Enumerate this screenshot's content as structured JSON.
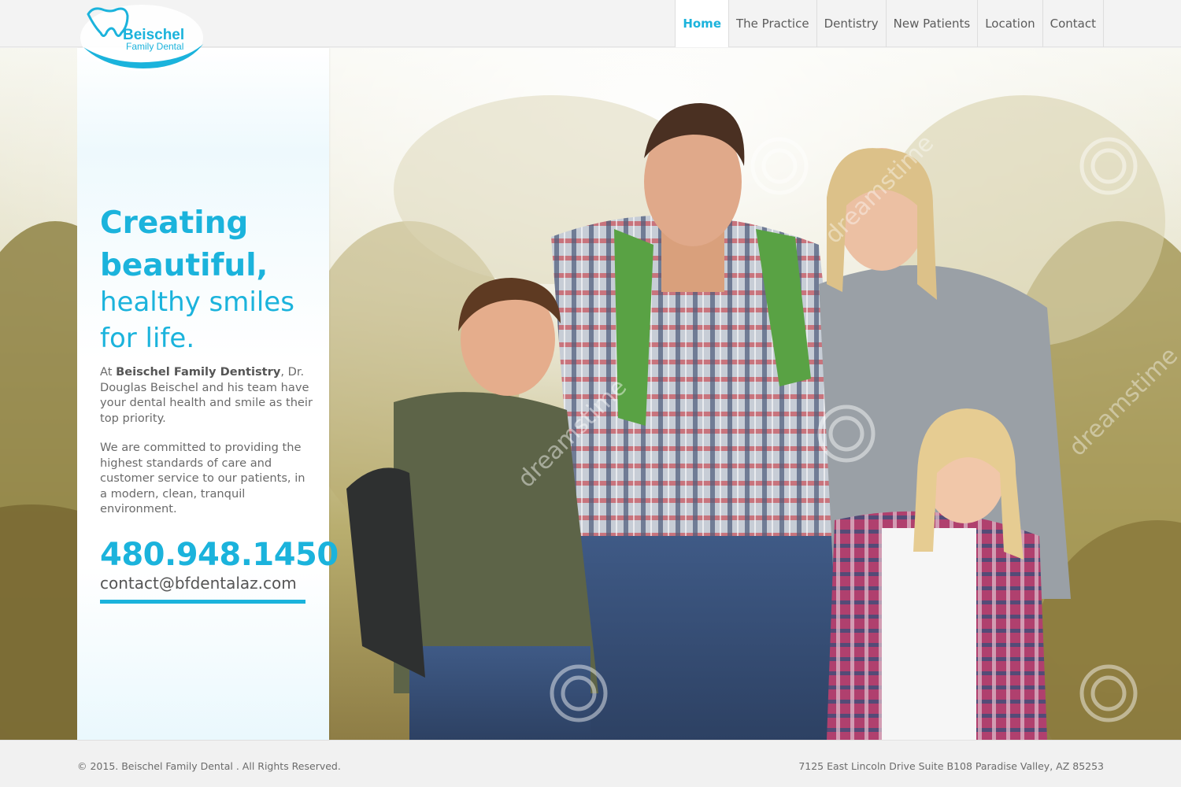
{
  "logo": {
    "name": "Beischel",
    "sub": "Family Dental"
  },
  "nav": {
    "items": [
      {
        "label": "Home"
      },
      {
        "label": "The Practice"
      },
      {
        "label": "Dentistry"
      },
      {
        "label": "New Patients"
      },
      {
        "label": "Location"
      },
      {
        "label": "Contact"
      }
    ],
    "active": "Home"
  },
  "hero": {
    "headline_bold_1": "Creating",
    "headline_bold_2": "beautiful,",
    "headline_light_1": "healthy smiles",
    "headline_light_2": "for life.",
    "p1_prefix": "At ",
    "p1_bold": "Beischel Family Dentistry",
    "p1_rest": ", Dr. Douglas Beischel and his team have your dental health and smile as their top priority.",
    "p2": "We are committed to providing the highest standards of care and customer service to our patients, in a modern, clean, tranquil environment.",
    "phone": "480.948.1450",
    "email": "contact@bfdentalaz.com",
    "watermark": "dreamstime"
  },
  "footer": {
    "copyright": "© 2015. Beischel Family Dental . All Rights Reserved.",
    "address": "7125 East Lincoln Drive Suite B108 Paradise Valley, AZ 85253"
  },
  "colors": {
    "accent": "#1bb3dc",
    "text": "#6a6a6a",
    "header_bg": "#f3f3f3"
  }
}
